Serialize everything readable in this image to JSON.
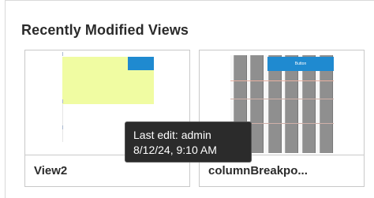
{
  "section": {
    "title": "Recently Modified Views"
  },
  "cards": [
    {
      "name": "View2"
    },
    {
      "name": "columnBreakpo...",
      "thumbnail_button_label": "Button"
    }
  ],
  "tooltip": {
    "line1": "Last edit: admin",
    "line2": "8/12/24, 9:10 AM"
  },
  "colors": {
    "thumbnail_blue": "#1f8ad0",
    "thumbnail_yellow": "#f0fca2",
    "tooltip_bg": "#2b2b2b"
  }
}
